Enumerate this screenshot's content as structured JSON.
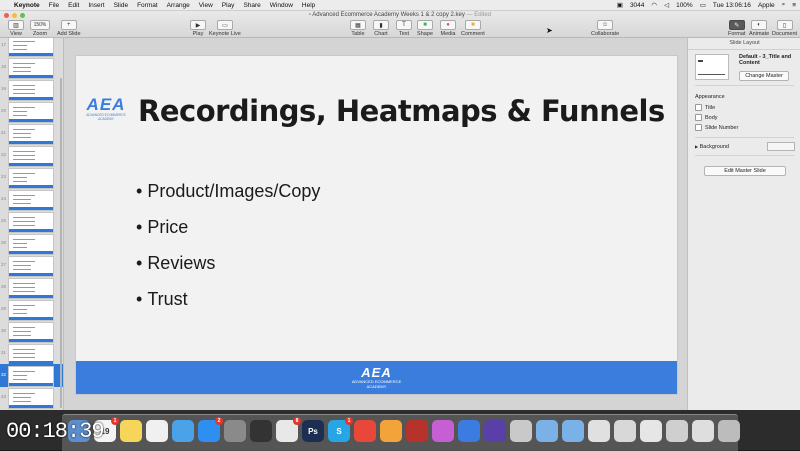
{
  "menubar": {
    "app_name": "Keynote",
    "items": [
      "File",
      "Edit",
      "Insert",
      "Slide",
      "Format",
      "Arrange",
      "View",
      "Play",
      "Share",
      "Window",
      "Help"
    ],
    "status": {
      "badge_count": "3044",
      "battery": "100%",
      "clock": "Tue 13:06:16",
      "user": "Apple"
    }
  },
  "window": {
    "title": "Advanced Ecommerce Academy Weeks 1 & 2 copy 2.key",
    "edited": "— Edited"
  },
  "toolbar": {
    "view_label": "View",
    "zoom_value": "150%",
    "zoom_label": "Zoom",
    "add_slide_label": "Add Slide",
    "play_label": "Play",
    "keynote_live_label": "Keynote Live",
    "table_label": "Table",
    "chart_label": "Chart",
    "text_label": "Text",
    "shape_label": "Shape",
    "media_label": "Media",
    "comment_label": "Comment",
    "collaborate_label": "Collaborate",
    "format_label": "Format",
    "animate_label": "Animate",
    "document_label": "Document"
  },
  "navigator": {
    "slides": [
      {
        "num": "17"
      },
      {
        "num": "18"
      },
      {
        "num": "19"
      },
      {
        "num": "20"
      },
      {
        "num": "21"
      },
      {
        "num": "22"
      },
      {
        "num": "23"
      },
      {
        "num": "24"
      },
      {
        "num": "25"
      },
      {
        "num": "26"
      },
      {
        "num": "27"
      },
      {
        "num": "28"
      },
      {
        "num": "29"
      },
      {
        "num": "30"
      },
      {
        "num": "31"
      },
      {
        "num": "32",
        "selected": true
      },
      {
        "num": "33"
      }
    ]
  },
  "slide": {
    "logo_mark": "AEA",
    "logo_sub": "ADVANCED ECOMMERCE ACADEMY",
    "title": "Recordings, Heatmaps & Funnels",
    "bullets": [
      "Product/Images/Copy",
      "Price",
      "Reviews",
      "Trust"
    ],
    "footer_mark": "AEA",
    "footer_sub1": "ADVANCED ECOMMERCE",
    "footer_sub2": "ACADEMY",
    "accent_color": "#3b7ddd"
  },
  "inspector": {
    "header": "Slide Layout",
    "master_name": "Default - 3_Title and Content",
    "change_master": "Change Master",
    "appearance_label": "Appearance",
    "options": [
      "Title",
      "Body",
      "Slide Number"
    ],
    "background_label": "Background",
    "edit_master": "Edit Master Slide"
  },
  "dock": {
    "icons": [
      {
        "name": "mail-icon",
        "color": "#5d8fd0"
      },
      {
        "name": "calendar-icon",
        "color": "#f4f4f4",
        "text": "19",
        "badge": "1"
      },
      {
        "name": "notes-icon",
        "color": "#f5d65b"
      },
      {
        "name": "photos-icon",
        "color": "#f0f0f0"
      },
      {
        "name": "cloud-icon",
        "color": "#4aa3e8"
      },
      {
        "name": "app-store-icon",
        "color": "#2f8ff0",
        "badge": "2"
      },
      {
        "name": "system-preferences-icon",
        "color": "#8a8a8a"
      },
      {
        "name": "terminal-icon",
        "color": "#333333"
      },
      {
        "name": "slack-icon",
        "color": "#e8e8e8",
        "badge": "8"
      },
      {
        "name": "photoshop-icon",
        "color": "#1c2f52",
        "text": "Ps"
      },
      {
        "name": "skype-icon",
        "color": "#27a6e5",
        "text": "S",
        "badge": "1"
      },
      {
        "name": "chrome-icon",
        "color": "#e8483a"
      },
      {
        "name": "daisy-icon",
        "color": "#f2a43a"
      },
      {
        "name": "photo-booth-icon",
        "color": "#b7322b"
      },
      {
        "name": "itunes-icon",
        "color": "#c65fd3"
      },
      {
        "name": "keynote-icon",
        "color": "#3a7ce0"
      },
      {
        "name": "imovie-icon",
        "color": "#5b3fa8"
      },
      {
        "name": "notepad-icon",
        "color": "#c9c9c9"
      },
      {
        "name": "folder-icon",
        "color": "#7ab1e6"
      },
      {
        "name": "downloads-folder-icon",
        "color": "#7ab1e6"
      },
      {
        "name": "window-thumb-icon",
        "color": "#e0e0e0"
      },
      {
        "name": "window-thumb-icon",
        "color": "#d8d8d8"
      },
      {
        "name": "window-thumb-icon",
        "color": "#e6e6e6"
      },
      {
        "name": "window-thumb-icon",
        "color": "#cfcfcf"
      },
      {
        "name": "window-thumb-icon",
        "color": "#dedede"
      },
      {
        "name": "trash-icon",
        "color": "#bcbcbc"
      }
    ]
  },
  "overlay": {
    "timer": "00:18:39"
  }
}
